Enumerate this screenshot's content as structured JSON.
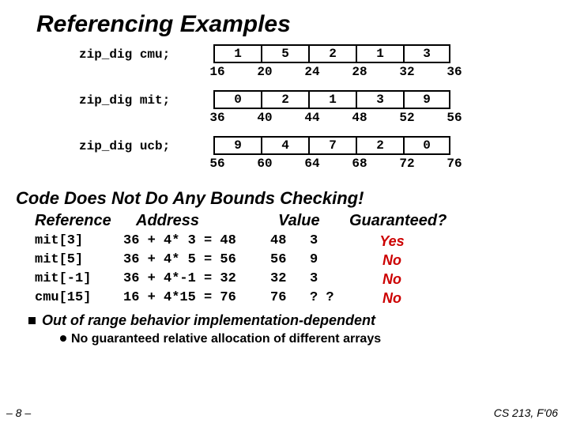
{
  "title": "Referencing Examples",
  "arrays": [
    {
      "label": "zip_dig cmu;",
      "cells": [
        "1",
        "5",
        "2",
        "1",
        "3"
      ],
      "addrs": [
        "16",
        "20",
        "24",
        "28",
        "32",
        "36"
      ]
    },
    {
      "label": "zip_dig mit;",
      "cells": [
        "0",
        "2",
        "1",
        "3",
        "9"
      ],
      "addrs": [
        "36",
        "40",
        "44",
        "48",
        "52",
        "56"
      ]
    },
    {
      "label": "zip_dig ucb;",
      "cells": [
        "9",
        "4",
        "7",
        "2",
        "0"
      ],
      "addrs": [
        "56",
        "60",
        "64",
        "68",
        "72",
        "76"
      ]
    }
  ],
  "section1": "Code Does Not Do Any Bounds Checking!",
  "tableHeader": {
    "ref": "Reference",
    "addr": "Address",
    "val": "Value",
    "guar": "Guaranteed?"
  },
  "rows": [
    {
      "ref": "mit[3]",
      "addr": "36 + 4* 3 = 48",
      "result": "48",
      "valn": "3",
      "guar": "Yes"
    },
    {
      "ref": "mit[5]",
      "addr": "36 + 4* 5 = 56",
      "result": "56",
      "valn": "9",
      "guar": "No"
    },
    {
      "ref": "mit[-1]",
      "addr": "36 + 4*-1 = 32",
      "result": "32",
      "valn": "3",
      "guar": "No"
    },
    {
      "ref": "cmu[15]",
      "addr": "16 + 4*15 = 76",
      "result": "76",
      "valn": "? ?",
      "guar": "No"
    }
  ],
  "bullet": "Out of range behavior implementation-dependent",
  "subbullet": "No guaranteed relative allocation of different arrays",
  "footerLeft": "– 8 –",
  "footerRight": "CS 213, F'06"
}
